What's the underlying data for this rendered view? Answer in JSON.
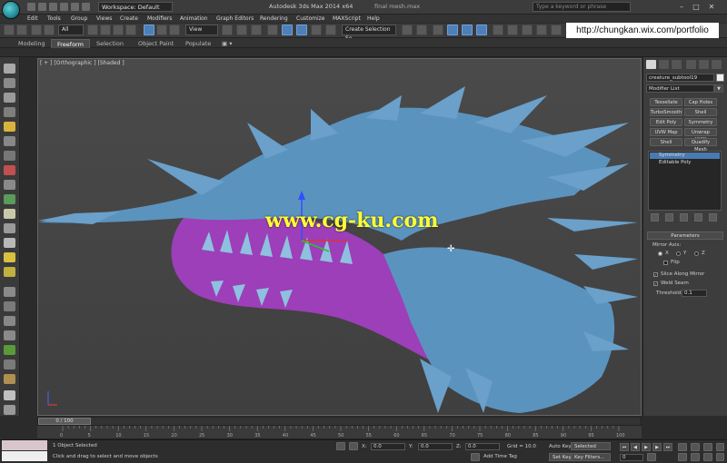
{
  "titlebar": {
    "workspace_label": "Workspace: Default",
    "app_title": "Autodesk 3ds Max 2014 x64",
    "document": "final mesh.max",
    "help_search_placeholder": "Type a keyword or phrase"
  },
  "menu": [
    "Edit",
    "Tools",
    "Group",
    "Views",
    "Create",
    "Modifiers",
    "Animation",
    "Graph Editors",
    "Rendering",
    "Customize",
    "MAXScript",
    "Help"
  ],
  "toolbar": {
    "selection_filter": "All",
    "ref_coord": "View",
    "named_selection": "Create Selection Se"
  },
  "portfolio_text": "http://chungkan.wix.com/portfolio",
  "ribbon_tabs": [
    "Modeling",
    "Freeform",
    "Selection",
    "Object Paint",
    "Populate"
  ],
  "ribbon_active": "Freeform",
  "viewport": {
    "label": "[ + ] [Orthographic ] [Shaded ]",
    "watermark": "www.cg-ku.com"
  },
  "command_panel": {
    "object_name": "creature_subtool19",
    "modifier_list": "Modifier List",
    "modifier_buttons": [
      "Tessellate",
      "Cap Holes",
      "TurboSmooth",
      "Shell",
      "Edit Poly",
      "Symmetry",
      "UVW Map",
      "Unwrap UVW",
      "Shell",
      "Quadify Mesh"
    ],
    "stack": [
      {
        "label": "Symmetry",
        "selected": true
      },
      {
        "label": "Editable Poly",
        "selected": false
      }
    ],
    "parameters": {
      "title": "Parameters",
      "mirror_axis_label": "Mirror Axis:",
      "axes": [
        "X",
        "Y",
        "Z"
      ],
      "selected_axis": "X",
      "flip_label": "Flip",
      "slice_label": "Slice Along Mirror",
      "weld_label": "Weld Seam",
      "threshold_label": "Threshold:",
      "threshold_value": "0.1"
    }
  },
  "timeline": {
    "slider_text": "0 / 100",
    "ticks": [
      "0",
      "5",
      "10",
      "15",
      "20",
      "25",
      "30",
      "35",
      "40",
      "45",
      "50",
      "55",
      "60",
      "65",
      "70",
      "75",
      "80",
      "85",
      "90",
      "95",
      "100"
    ]
  },
  "status": {
    "selection": "1 Object Selected",
    "prompt": "Click and drag to select and move objects",
    "x_label": "X:",
    "x_value": "0.0",
    "y_label": "Y:",
    "y_value": "0.0",
    "z_label": "Z:",
    "z_value": "0.0",
    "grid": "Grid = 10.0",
    "add_time_tag": "Add Time Tag",
    "auto_key": "Auto Key",
    "set_key": "Set Key",
    "key_mode": "Selected",
    "key_filters": "Key Filters...",
    "frame": "0"
  }
}
